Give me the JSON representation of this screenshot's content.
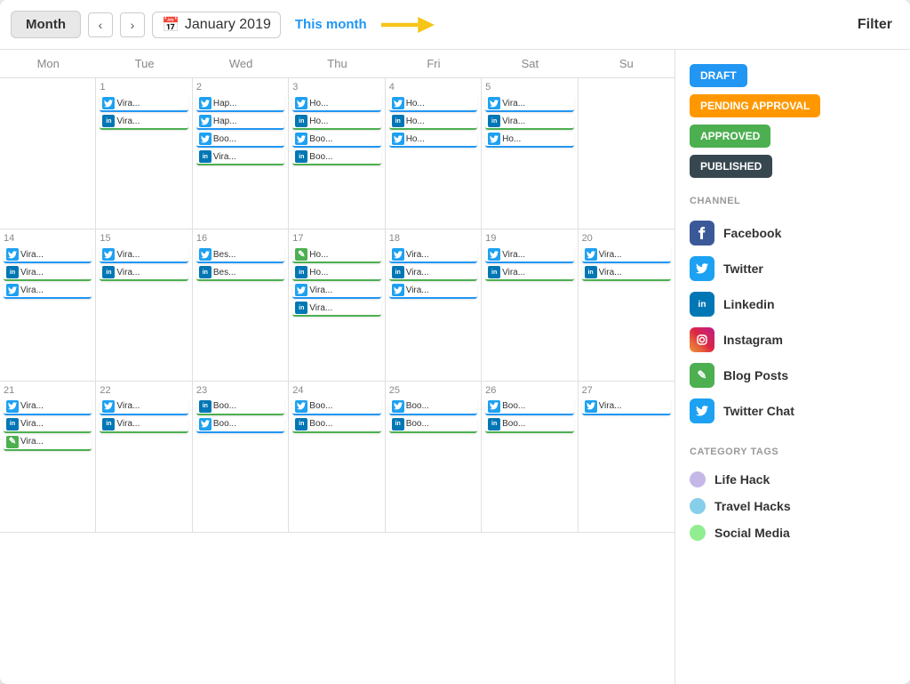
{
  "header": {
    "month_btn": "Month",
    "date": "January 2019",
    "calendar_icon": "📅",
    "this_month": "This month",
    "filter": "Filter"
  },
  "day_headers": [
    "Mon",
    "Tue",
    "Wed",
    "Thu",
    "Fri",
    "Sat",
    "Su"
  ],
  "weeks": [
    {
      "days": [
        {
          "num": "",
          "posts": []
        },
        {
          "num": "1",
          "posts": [
            {
              "icon": "tw",
              "text": "Vira...",
              "border": "blue"
            },
            {
              "icon": "li",
              "text": "Vira...",
              "border": "green"
            }
          ]
        },
        {
          "num": "2",
          "posts": [
            {
              "icon": "tw",
              "text": "Hap...",
              "border": "blue"
            },
            {
              "icon": "tw",
              "text": "Hap...",
              "border": "blue"
            },
            {
              "icon": "tw",
              "text": "Boo...",
              "border": "blue"
            },
            {
              "icon": "li",
              "text": "Vira...",
              "border": "green"
            }
          ]
        },
        {
          "num": "3",
          "posts": [
            {
              "icon": "tw",
              "text": "Ho...",
              "border": "blue"
            },
            {
              "icon": "li",
              "text": "Ho...",
              "border": "green"
            },
            {
              "icon": "tw",
              "text": "Boo...",
              "border": "blue"
            },
            {
              "icon": "li",
              "text": "Boo...",
              "border": "green"
            }
          ]
        },
        {
          "num": "4",
          "posts": [
            {
              "icon": "tw",
              "text": "Ho...",
              "border": "blue"
            },
            {
              "icon": "li",
              "text": "Ho...",
              "border": "green"
            },
            {
              "icon": "tw",
              "text": "Ho...",
              "border": "blue"
            }
          ]
        },
        {
          "num": "5",
          "posts": [
            {
              "icon": "tw",
              "text": "Vira...",
              "border": "blue"
            },
            {
              "icon": "li",
              "text": "Vira...",
              "border": "green"
            },
            {
              "icon": "tw",
              "text": "Ho...",
              "border": "blue"
            }
          ]
        },
        {
          "num": "",
          "posts": []
        }
      ]
    },
    {
      "days": [
        {
          "num": "14",
          "posts": [
            {
              "icon": "tw",
              "text": "Vira...",
              "border": "blue"
            },
            {
              "icon": "li",
              "text": "Vira...",
              "border": "green"
            },
            {
              "icon": "tw",
              "text": "Vira...",
              "border": "blue"
            }
          ]
        },
        {
          "num": "15",
          "posts": [
            {
              "icon": "tw",
              "text": "Vira...",
              "border": "blue"
            },
            {
              "icon": "li",
              "text": "Vira...",
              "border": "green"
            }
          ]
        },
        {
          "num": "16",
          "posts": [
            {
              "icon": "tw",
              "text": "Bes...",
              "border": "blue"
            },
            {
              "icon": "li",
              "text": "Bes...",
              "border": "green"
            }
          ]
        },
        {
          "num": "17",
          "posts": [
            {
              "icon": "bp",
              "text": "Ho...",
              "border": "green"
            },
            {
              "icon": "li",
              "text": "Ho...",
              "border": "green"
            },
            {
              "icon": "tw",
              "text": "Vira...",
              "border": "blue"
            },
            {
              "icon": "li",
              "text": "Vira...",
              "border": "green"
            }
          ]
        },
        {
          "num": "18",
          "posts": [
            {
              "icon": "tw",
              "text": "Vira...",
              "border": "blue"
            },
            {
              "icon": "li",
              "text": "Vira...",
              "border": "green"
            },
            {
              "icon": "tw",
              "text": "Vira...",
              "border": "blue"
            }
          ]
        },
        {
          "num": "19",
          "posts": [
            {
              "icon": "tw",
              "text": "Vira...",
              "border": "blue"
            },
            {
              "icon": "li",
              "text": "Vira...",
              "border": "green"
            }
          ]
        },
        {
          "num": "20",
          "posts": [
            {
              "icon": "tw",
              "text": "Vira...",
              "border": "blue"
            },
            {
              "icon": "li",
              "text": "Vira...",
              "border": "green"
            }
          ]
        }
      ]
    },
    {
      "days": [
        {
          "num": "21",
          "posts": [
            {
              "icon": "tw",
              "text": "Vira...",
              "border": "blue"
            },
            {
              "icon": "li",
              "text": "Vira...",
              "border": "green"
            },
            {
              "icon": "bp",
              "text": "Vira...",
              "border": "green"
            }
          ]
        },
        {
          "num": "22",
          "posts": [
            {
              "icon": "tw",
              "text": "Vira...",
              "border": "blue"
            },
            {
              "icon": "li",
              "text": "Vira...",
              "border": "green"
            }
          ]
        },
        {
          "num": "23",
          "posts": [
            {
              "icon": "li",
              "text": "Boo...",
              "border": "green"
            },
            {
              "icon": "tw",
              "text": "Boo...",
              "border": "blue"
            }
          ]
        },
        {
          "num": "24",
          "posts": [
            {
              "icon": "tw",
              "text": "Boo...",
              "border": "blue"
            },
            {
              "icon": "li",
              "text": "Boo...",
              "border": "green"
            }
          ]
        },
        {
          "num": "25",
          "posts": [
            {
              "icon": "tw",
              "text": "Boo...",
              "border": "blue"
            },
            {
              "icon": "li",
              "text": "Boo...",
              "border": "green"
            }
          ]
        },
        {
          "num": "26",
          "posts": [
            {
              "icon": "tw",
              "text": "Boo...",
              "border": "blue"
            },
            {
              "icon": "li",
              "text": "Boo...",
              "border": "green"
            }
          ]
        },
        {
          "num": "27",
          "posts": [
            {
              "icon": "tw",
              "text": "Vira...",
              "border": "blue"
            }
          ]
        }
      ]
    }
  ],
  "sidebar": {
    "status_label": "",
    "statuses": [
      {
        "label": "DRAFT",
        "cls": "badge-draft"
      },
      {
        "label": "PENDING APPROVAL",
        "cls": "badge-pending"
      },
      {
        "label": "APPROVED",
        "cls": "badge-approved"
      },
      {
        "label": "PUBLISHED",
        "cls": "badge-published"
      }
    ],
    "channel_title": "CHANNEL",
    "channels": [
      {
        "name": "Facebook",
        "cls": "ch-facebook",
        "icon": "f"
      },
      {
        "name": "Twitter",
        "cls": "ch-twitter",
        "icon": "t"
      },
      {
        "name": "Linkedin",
        "cls": "ch-linkedin",
        "icon": "in"
      },
      {
        "name": "Instagram",
        "cls": "ch-instagram",
        "icon": "ig"
      },
      {
        "name": "Blog Posts",
        "cls": "ch-blog",
        "icon": "✎"
      },
      {
        "name": "Twitter Chat",
        "cls": "ch-twitterchat",
        "icon": "t"
      }
    ],
    "category_title": "CATEGORY TAGS",
    "categories": [
      {
        "name": "Life Hack",
        "dot": "dot-lifehack"
      },
      {
        "name": "Travel Hacks",
        "dot": "dot-travel"
      },
      {
        "name": "Social Media",
        "dot": "dot-social"
      }
    ]
  }
}
